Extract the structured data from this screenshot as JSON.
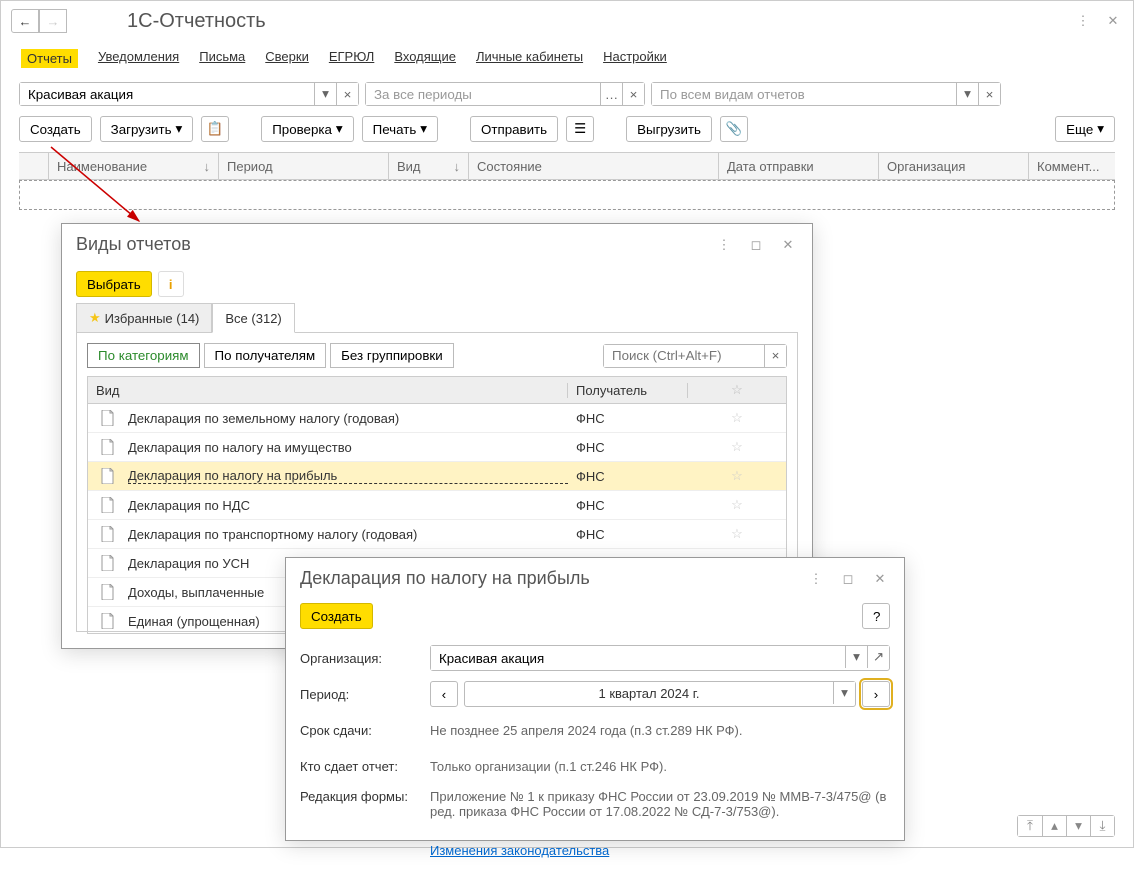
{
  "title": "1С-Отчетность",
  "tabs": {
    "reports": "Отчеты",
    "notifications": "Уведомления",
    "letters": "Письма",
    "reconciliations": "Сверки",
    "egrul": "ЕГРЮЛ",
    "incoming": "Входящие",
    "cabinets": "Личные кабинеты",
    "settings": "Настройки"
  },
  "filters": {
    "org_value": "Красивая акация",
    "period_placeholder": "За все периоды",
    "type_placeholder": "По всем видам отчетов"
  },
  "toolbar": {
    "create": "Создать",
    "load": "Загрузить",
    "check": "Проверка",
    "print": "Печать",
    "send": "Отправить",
    "export": "Выгрузить",
    "more": "Еще"
  },
  "grid": {
    "name": "Наименование",
    "period": "Период",
    "kind": "Вид",
    "state": "Состояние",
    "sent_date": "Дата отправки",
    "organization": "Организация",
    "comment": "Коммент..."
  },
  "dlg1": {
    "title": "Виды отчетов",
    "select": "Выбрать",
    "tab_fav": "Избранные (14)",
    "tab_all": "Все (312)",
    "by_category": "По категориям",
    "by_recipient": "По получателям",
    "no_group": "Без группировки",
    "search_placeholder": "Поиск (Ctrl+Alt+F)",
    "col_kind": "Вид",
    "col_recipient": "Получатель",
    "rows": [
      {
        "name": "Декларация по земельному налогу (годовая)",
        "recv": "ФНС",
        "selected": false
      },
      {
        "name": "Декларация по налогу на имущество",
        "recv": "ФНС",
        "selected": false
      },
      {
        "name": "Декларация по налогу на прибыль",
        "recv": "ФНС",
        "selected": true
      },
      {
        "name": "Декларация по НДС",
        "recv": "ФНС",
        "selected": false
      },
      {
        "name": "Декларация по транспортному налогу (годовая)",
        "recv": "ФНС",
        "selected": false
      },
      {
        "name": "Декларация по УСН",
        "recv": "",
        "selected": false
      },
      {
        "name": "Доходы, выплаченные",
        "recv": "",
        "selected": false
      },
      {
        "name": "Единая (упрощенная)",
        "recv": "",
        "selected": false
      }
    ]
  },
  "dlg2": {
    "title": "Декларация по налогу на прибыль",
    "create": "Создать",
    "org_label": "Организация:",
    "org_value": "Красивая акация",
    "period_label": "Период:",
    "period_value": "1 квартал 2024 г.",
    "deadline_label": "Срок сдачи:",
    "deadline_value": "Не позднее 25 апреля 2024 года (п.3 ст.289 НК РФ).",
    "who_label": "Кто сдает отчет:",
    "who_value": "Только организации (п.1 ст.246 НК РФ).",
    "form_label": "Редакция формы:",
    "form_value": "Приложение № 1 к приказу ФНС России от 23.09.2019 № ММВ-7-3/475@ (в ред. приказа ФНС России от 17.08.2022 № СД-7-3/753@).",
    "law_link": "Изменения законодательства"
  }
}
